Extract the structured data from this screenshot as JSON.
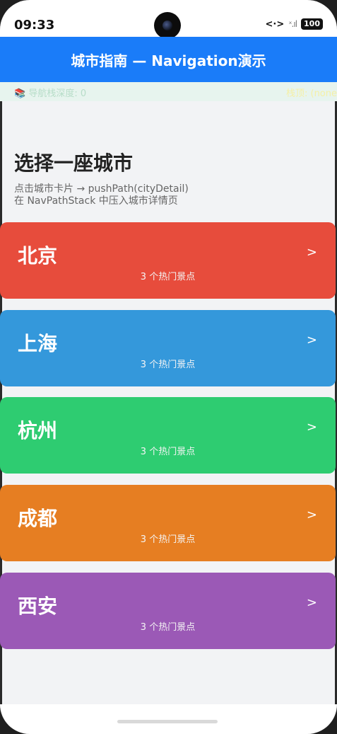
{
  "status": {
    "time": "09:33",
    "network": "<·>",
    "signal_label": "ˣ.ıl",
    "battery": "100"
  },
  "header": {
    "title": "城市指南 — Navigation演示"
  },
  "debug": {
    "stack_depth": "📚 导航栈深度: 0",
    "top": "栈顶: (none"
  },
  "main": {
    "title": "选择一座城市",
    "subtitle_line1": "点击城市卡片 → pushPath(cityDetail)",
    "subtitle_line2": "在 NavPathStack 中压入城市详情页"
  },
  "cities": [
    {
      "name": "北京",
      "spots": "3 个热门景点",
      "arrow": ">",
      "color": "#e74c3c"
    },
    {
      "name": "上海",
      "spots": "3 个热门景点",
      "arrow": ">",
      "color": "#3498db"
    },
    {
      "name": "杭州",
      "spots": "3 个热门景点",
      "arrow": ">",
      "color": "#2ecc71"
    },
    {
      "name": "成都",
      "spots": "3 个热门景点",
      "arrow": ">",
      "color": "#e67e22"
    },
    {
      "name": "西安",
      "spots": "3 个热门景点",
      "arrow": ">",
      "color": "#9b59b6"
    }
  ]
}
